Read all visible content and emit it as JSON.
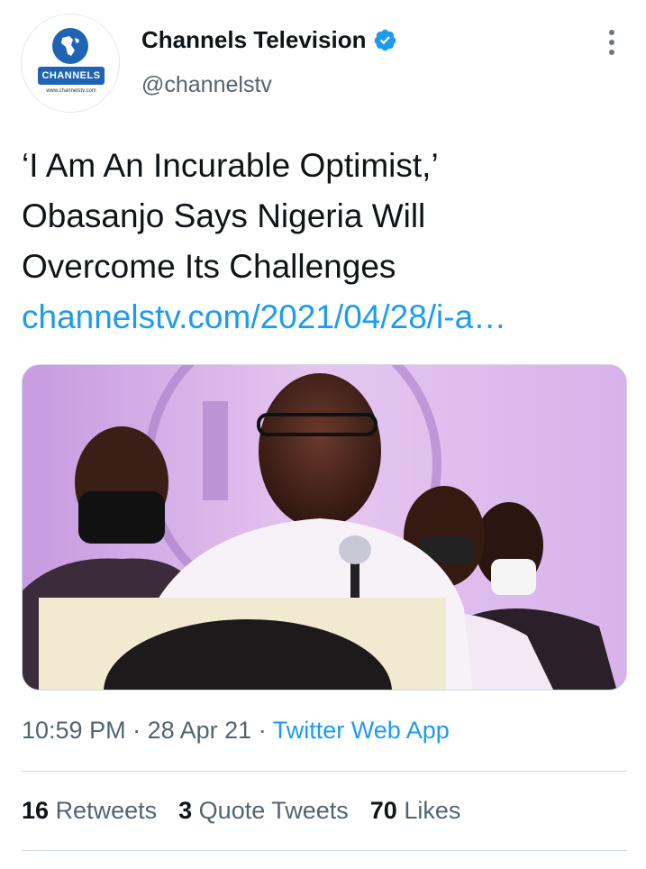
{
  "author": {
    "display_name": "Channels Television",
    "handle": "@channelstv",
    "avatar_logo_text": "CHANNELS",
    "avatar_logo_url": "www.channelstv.com"
  },
  "tweet": {
    "text_lines": [
      "‘I Am An Incurable Optimist,’",
      "Obasanjo Says Nigeria Will",
      "Overcome Its Challenges"
    ],
    "link": "channelstv.com/2021/04/28/i-a…"
  },
  "meta": {
    "time": "10:59 PM",
    "separator": "·",
    "date": "28 Apr 21",
    "source_app": "Twitter Web App"
  },
  "stats": {
    "retweets_count": "16",
    "retweets_label": "Retweets",
    "quotes_count": "3",
    "quotes_label": "Quote Tweets",
    "likes_count": "70",
    "likes_label": "Likes"
  },
  "colors": {
    "link_blue": "#1d9bf0",
    "verified_blue": "#1d9bf0",
    "secondary_text": "#536471",
    "primary_text": "#0f1419"
  },
  "icons": {
    "verified": "verified-badge-icon",
    "more": "more-vertical-icon"
  }
}
